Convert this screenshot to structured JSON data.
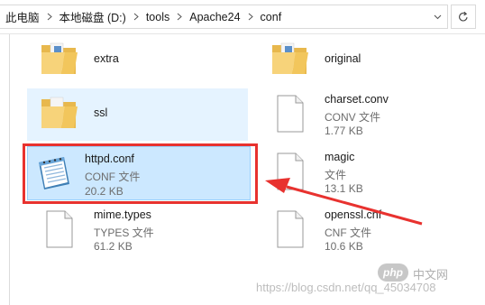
{
  "breadcrumb": [
    "此电脑",
    "本地磁盘 (D:)",
    "tools",
    "Apache24",
    "conf"
  ],
  "files": [
    {
      "name": "extra",
      "type": "",
      "size": "",
      "icon": "folder-icon"
    },
    {
      "name": "original",
      "type": "",
      "size": "",
      "icon": "folder-icon"
    },
    {
      "name": "ssl",
      "type": "",
      "size": "",
      "icon": "folder-icon"
    },
    {
      "name": "charset.conv",
      "type": "CONV 文件",
      "size": "1.77 KB",
      "icon": "blank-file-icon"
    },
    {
      "name": "httpd.conf",
      "type": "CONF 文件",
      "size": "20.2 KB",
      "icon": "notepad-icon"
    },
    {
      "name": "magic",
      "type": "文件",
      "size": "13.1 KB",
      "icon": "blank-file-icon"
    },
    {
      "name": "mime.types",
      "type": "TYPES 文件",
      "size": "61.2 KB",
      "icon": "blank-file-icon"
    },
    {
      "name": "openssl.cnf",
      "type": "CNF 文件",
      "size": "10.6 KB",
      "icon": "blank-file-icon"
    }
  ],
  "watermark": {
    "logo_text": "php",
    "site_text": "中文网",
    "url_text": "https://blog.csdn.net/qq_45034708"
  },
  "colors": {
    "selection_bg": "#cce8ff",
    "selection_border": "#99d1ff",
    "hover_bg": "#e5f3ff",
    "annotation_red": "#e8322f"
  }
}
